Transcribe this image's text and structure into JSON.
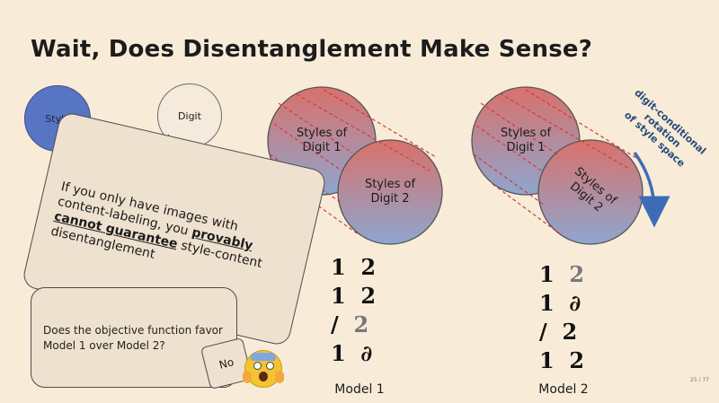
{
  "slide": {
    "title": "Wait, Does Disentanglement Make Sense?",
    "page_number": "25 / 77"
  },
  "bubbles": {
    "style": "Style",
    "digit": "Digit"
  },
  "main_card": {
    "line1": "If you only have images with",
    "line2_pre": "content-labeling, you ",
    "line2_bold": "provably",
    "line3_bold": "cannot guarantee",
    "line3_post": " style-content",
    "line4": "disentanglement"
  },
  "question_card": {
    "text": "Does the objective function favor Model 1 over Model 2?",
    "answer": "No",
    "emoji": "face-screaming-in-fear"
  },
  "models": [
    {
      "label": "Model 1",
      "circle1": [
        "Styles of",
        "Digit 1"
      ],
      "circle2": [
        "Styles of",
        "Digit 2"
      ],
      "digit_rows": [
        [
          "1",
          "2"
        ],
        [
          "1",
          "2"
        ],
        [
          "/",
          "2"
        ],
        [
          "1",
          "∂"
        ]
      ]
    },
    {
      "label": "Model 2",
      "circle1": [
        "Styles of",
        "Digit 1"
      ],
      "circle2": [
        "Styles of",
        "Digit 2"
      ],
      "digit_rows": [
        [
          "1",
          "2"
        ],
        [
          "1",
          "∂"
        ],
        [
          "/",
          "2"
        ],
        [
          "1",
          "2"
        ]
      ]
    }
  ],
  "rotation_label": [
    "digit-conditional rotation",
    "of style space"
  ],
  "colors": {
    "background": "#f8ecd8",
    "style_bubble": "#5875c4",
    "gradient_top": "#d9716a",
    "gradient_bottom": "#8ea6cf",
    "dashed_lines": "#d63a3a",
    "arrow": "#3e6bb5"
  }
}
